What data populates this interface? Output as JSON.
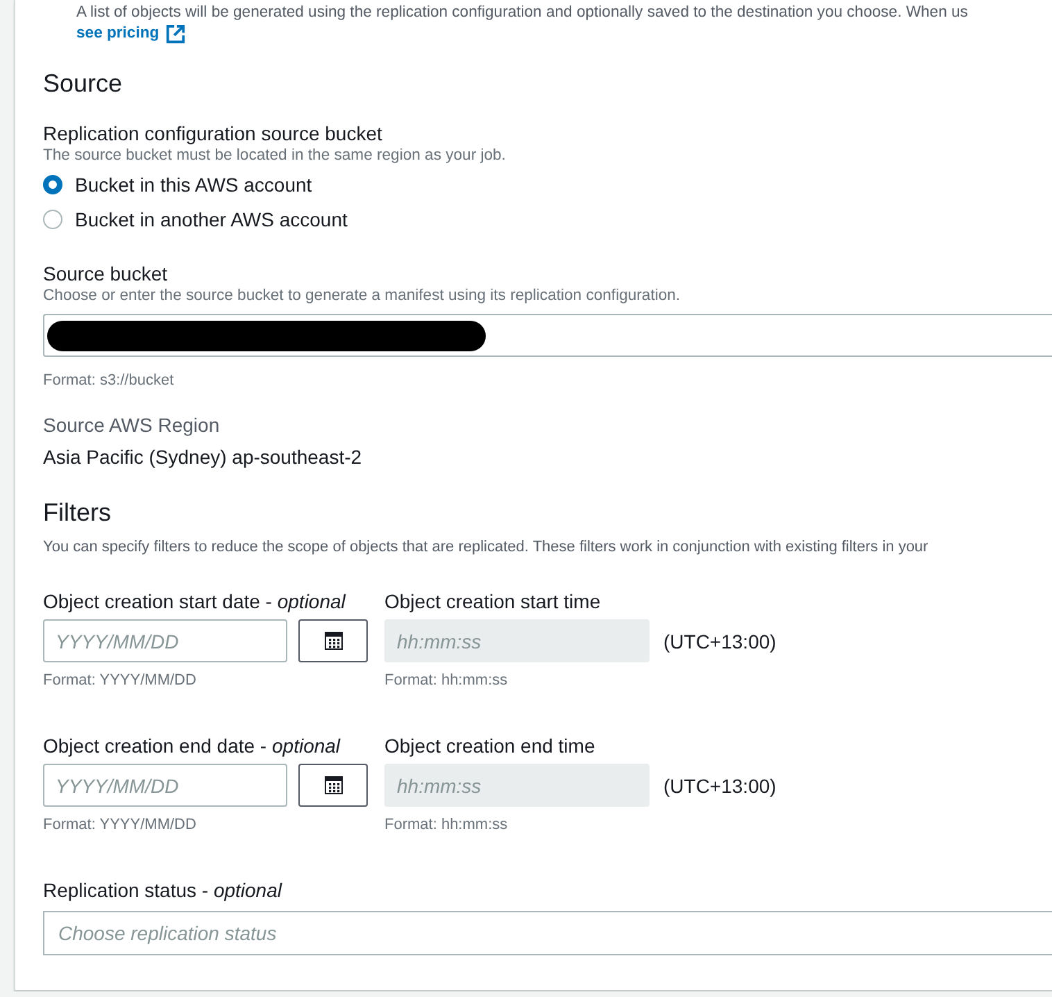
{
  "intro": {
    "text": "A list of objects will be generated using the replication configuration and optionally saved to the destination you choose. When us",
    "link": "see pricing"
  },
  "source": {
    "heading": "Source",
    "bucket_choice": {
      "label": "Replication configuration source bucket",
      "hint": "The source bucket must be located in the same region as your job.",
      "options": [
        {
          "label": "Bucket in this AWS account",
          "selected": true
        },
        {
          "label": "Bucket in another AWS account",
          "selected": false
        }
      ]
    },
    "source_bucket": {
      "label": "Source bucket",
      "hint": "Choose or enter the source bucket to generate a manifest using its replication configuration.",
      "redacted": true,
      "format": "Format: s3://bucket"
    },
    "region": {
      "label": "Source AWS Region",
      "value": "Asia Pacific (Sydney) ap-southeast-2"
    }
  },
  "filters": {
    "heading": "Filters",
    "description": "You can specify filters to reduce the scope of objects that are replicated. These filters work in conjunction with existing filters in your",
    "ranges": [
      {
        "date_label": "Object creation start date - *optional*",
        "date_placeholder": "YYYY/MM/DD",
        "date_format": "Format: YYYY/MM/DD",
        "time_label": "Object creation start time",
        "time_placeholder": "hh:mm:ss",
        "time_disabled": true,
        "time_format": "Format: hh:mm:ss",
        "timezone": "(UTC+13:00)"
      },
      {
        "date_label": "Object creation end date - *optional*",
        "date_placeholder": "YYYY/MM/DD",
        "date_format": "Format: YYYY/MM/DD",
        "time_label": "Object creation end time",
        "time_placeholder": "hh:mm:ss",
        "time_disabled": true,
        "time_format": "Format: hh:mm:ss",
        "timezone": "(UTC+13:00)"
      }
    ],
    "replication_status": {
      "label": "Replication status - *optional*",
      "placeholder": "Choose replication status"
    }
  }
}
